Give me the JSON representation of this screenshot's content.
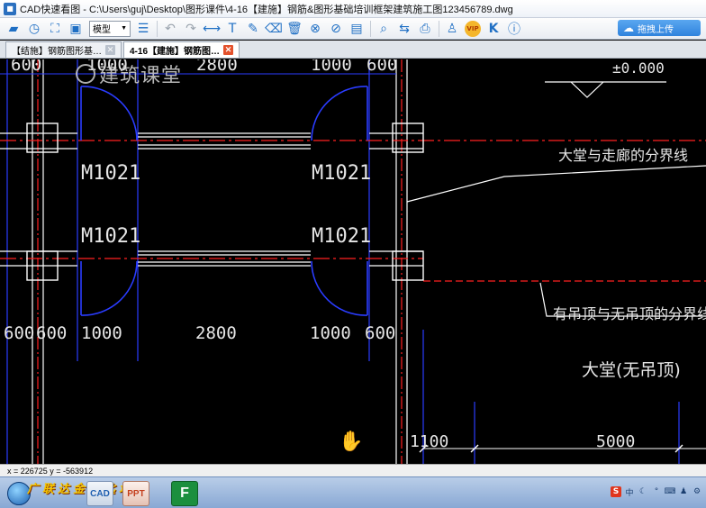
{
  "window": {
    "title": "CAD快速看图 - C:\\Users\\guj\\Desktop\\图形课件\\4-16【建施】钢筋&图形基础培训框架建筑施工图123456789.dwg"
  },
  "toolbar": {
    "model_select_value": "模型",
    "upload_label": "拖拽上传",
    "vip_label": "VIP",
    "icons": [
      "open-icon",
      "recent-icon",
      "fit-icon",
      "window-zoom-icon",
      "layer-icon",
      "undo-icon",
      "redo-icon",
      "measure-icon",
      "text-icon",
      "pen-icon",
      "eraser-icon",
      "delete-icon",
      "layer-hide-icon",
      "eye-off-icon",
      "annotation-icon",
      "search-icon",
      "convert-icon",
      "print-icon",
      "user-icon",
      "vip-icon",
      "k-icon",
      "info-icon"
    ]
  },
  "tabs": [
    {
      "label": "【结施】钢筋图形基…",
      "active": false
    },
    {
      "label": "4-16【建施】钢筋图…",
      "active": true
    }
  ],
  "watermark": {
    "text": "建筑课堂"
  },
  "drawing": {
    "top_dims": [
      "600",
      "1000",
      "2800",
      "1000",
      "600"
    ],
    "elevation": "±0.000",
    "door_labels": [
      "M1021",
      "M1021",
      "M1021",
      "M1021"
    ],
    "bottom_dims": [
      "600",
      "600",
      "1000",
      "2800",
      "1000",
      "600"
    ],
    "annotations": {
      "lobby_corridor": "大堂与走廊的分界线",
      "ceiling_boundary": "有吊顶与无吊顶的分界线",
      "lobby_room": "大堂(无吊顶)"
    },
    "lower_dims": [
      "1100",
      "5000"
    ],
    "colors": {
      "wall": "#ffffff",
      "axis": "#ff2020",
      "door": "#2a3cff",
      "grid": "#2a3cff"
    }
  },
  "status": {
    "coords": "x = 226725  y = -563912"
  },
  "taskbar": {
    "banner": "广联达金钥匙培训",
    "apps": [
      "CAD",
      "PPT",
      "F"
    ]
  }
}
